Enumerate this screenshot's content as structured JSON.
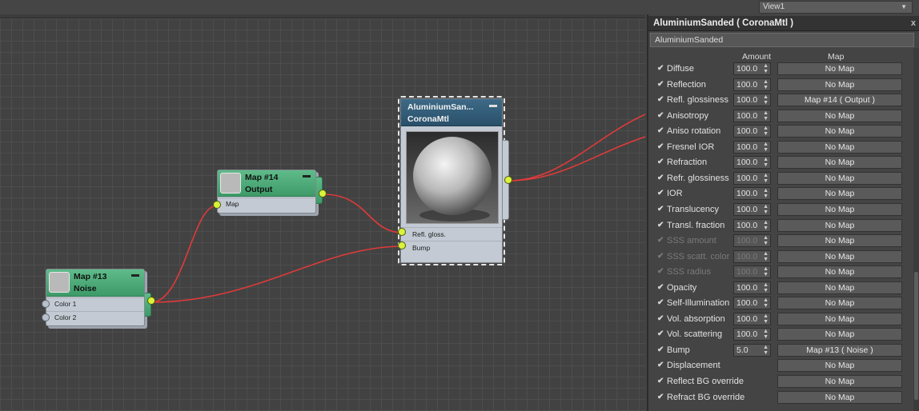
{
  "view_dropdown": {
    "label": "View1"
  },
  "nodes": {
    "map14": {
      "title": "Map #14",
      "subtitle": "Output",
      "slot": "Map"
    },
    "map13": {
      "title": "Map #13",
      "subtitle": "Noise",
      "slots": [
        "Color 1",
        "Color 2"
      ]
    },
    "material": {
      "title": "AluminiumSan...",
      "subtitle": "CoronaMtl",
      "slots": [
        "Refl. gloss.",
        "Bump"
      ]
    }
  },
  "panel": {
    "title": "AluminiumSanded  ( CoronaMtl )",
    "close": "x",
    "name_field": "AluminiumSanded",
    "col_amount": "Amount",
    "col_map": "Map",
    "check_glyph": "✔",
    "spinner_glyph": "▴▾",
    "params": [
      {
        "label": "Diffuse",
        "amount": "100.0",
        "map": "No Map",
        "enabled": true
      },
      {
        "label": "Reflection",
        "amount": "100.0",
        "map": "No Map",
        "enabled": true
      },
      {
        "label": "Refl. glossiness",
        "amount": "100.0",
        "map": "Map #14  ( Output )",
        "enabled": true
      },
      {
        "label": "Anisotropy",
        "amount": "100.0",
        "map": "No Map",
        "enabled": true
      },
      {
        "label": "Aniso rotation",
        "amount": "100.0",
        "map": "No Map",
        "enabled": true
      },
      {
        "label": "Fresnel IOR",
        "amount": "100.0",
        "map": "No Map",
        "enabled": true
      },
      {
        "label": "Refraction",
        "amount": "100.0",
        "map": "No Map",
        "enabled": true
      },
      {
        "label": "Refr. glossiness",
        "amount": "100.0",
        "map": "No Map",
        "enabled": true
      },
      {
        "label": "IOR",
        "amount": "100.0",
        "map": "No Map",
        "enabled": true
      },
      {
        "label": "Translucency",
        "amount": "100.0",
        "map": "No Map",
        "enabled": true
      },
      {
        "label": "Transl. fraction",
        "amount": "100.0",
        "map": "No Map",
        "enabled": true
      },
      {
        "label": "SSS amount",
        "amount": "100.0",
        "map": "No Map",
        "enabled": false
      },
      {
        "label": "SSS scatt. color",
        "amount": "100.0",
        "map": "No Map",
        "enabled": false
      },
      {
        "label": "SSS radius",
        "amount": "100.0",
        "map": "No Map",
        "enabled": false
      },
      {
        "label": "Opacity",
        "amount": "100.0",
        "map": "No Map",
        "enabled": true
      },
      {
        "label": "Self-Illumination",
        "amount": "100.0",
        "map": "No Map",
        "enabled": true
      },
      {
        "label": "Vol. absorption",
        "amount": "100.0",
        "map": "No Map",
        "enabled": true
      },
      {
        "label": "Vol. scattering",
        "amount": "100.0",
        "map": "No Map",
        "enabled": true
      },
      {
        "label": "Bump",
        "amount": "5.0",
        "map": "Map #13  ( Noise )",
        "enabled": true
      },
      {
        "label": "Displacement",
        "amount": "",
        "map": "No Map",
        "enabled": true
      },
      {
        "label": "Reflect BG override",
        "amount": "",
        "map": "No Map",
        "enabled": true
      },
      {
        "label": "Refract BG override",
        "amount": "",
        "map": "No Map",
        "enabled": true
      }
    ]
  },
  "colors": {
    "node_header_green": "#4aa876",
    "material_header_blue": "#2f5a76",
    "port_yellow": "#d9f23a",
    "wire_red": "#e03a3a"
  }
}
